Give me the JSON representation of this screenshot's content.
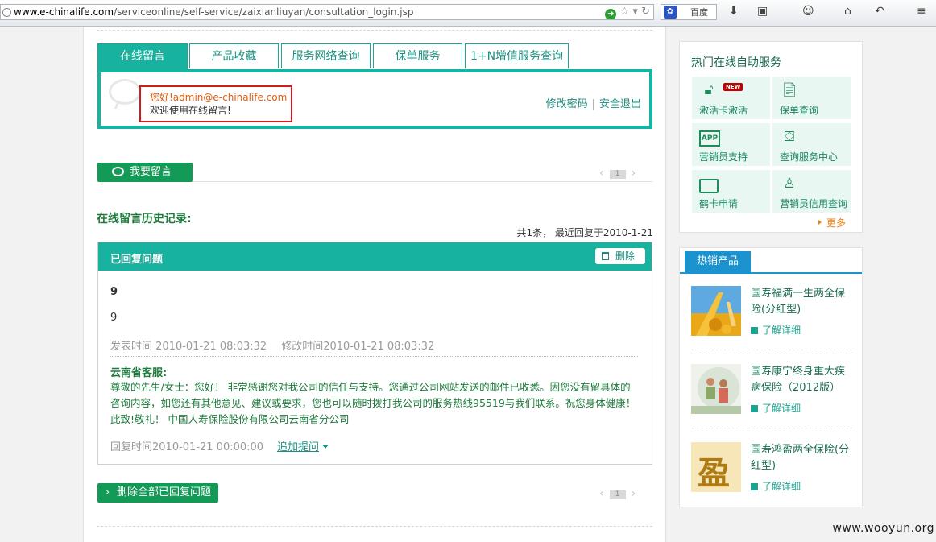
{
  "browser": {
    "url_host": "www.e-chinalife.com",
    "url_path": "/serviceonline/self-service/zaixianliuyan/consultation_login.jsp",
    "search_label": "百度"
  },
  "tabs": [
    {
      "label": "在线留言",
      "active": true
    },
    {
      "label": "产品收藏",
      "active": false
    },
    {
      "label": "服务网络查询",
      "active": false
    },
    {
      "label": "保单服务",
      "active": false
    },
    {
      "label": "1+N增值服务查询",
      "active": false
    }
  ],
  "user": {
    "greeting": "您好!admin@e-chinalife.com",
    "welcome": "欢迎使用在线留言!",
    "change_password": "修改密码",
    "separator": "|",
    "logout": "安全退出"
  },
  "leave_message_button": "我要留言",
  "pager": {
    "prev": "‹",
    "page": "1",
    "next": "›"
  },
  "history": {
    "title": "在线留言历史记录:",
    "summary": "共1条， 最近回复于2010-1-21"
  },
  "message": {
    "header": "已回复问题",
    "delete_label": "删除",
    "title": "9",
    "body": "9",
    "post_time": "发表时间 2010-01-21 08:03:32",
    "modify_time": "修改时间2010-01-21 08:03:32",
    "reply_author": "云南省客服:",
    "reply_text": "尊敬的先生/女士：您好！ 非常感谢您对我公司的信任与支持。您通过公司网站发送的邮件已收悉。因您没有留具体的咨询内容，如您还有其他意见、建议或要求，您也可以随时拨打我公司的服务热线95519与我们联系。祝您身体健康！ 此致!敬礼！ 中国人寿保险股份有限公司云南省分公司",
    "reply_time": "回复时间2010-01-21 00:00:00",
    "add_question": "追加提问"
  },
  "delete_all_button": "删除全部已回复问题",
  "services": {
    "title": "热门在线自助服务",
    "items": [
      {
        "label": "激活卡激活",
        "icon": "unlock-icon",
        "badge": "NEW"
      },
      {
        "label": "保单查询",
        "icon": "document-search-icon"
      },
      {
        "label": "营销员支持",
        "icon": "app-icon",
        "icon_text": "APP"
      },
      {
        "label": "查询服务中心",
        "icon": "map-icon"
      },
      {
        "label": "鹤卡申请",
        "icon": "card-icon"
      },
      {
        "label": "营销员信用查询",
        "icon": "person-search-icon"
      }
    ],
    "more": "更多"
  },
  "hot_products": {
    "tab_label": "热销产品",
    "items": [
      {
        "name": "国寿福满一生两全保险(分红型)",
        "link": "了解详细"
      },
      {
        "name": "国寿康宁终身重大疾病保险（2012版）",
        "link": "了解详细"
      },
      {
        "name": "国寿鸿盈两全保险(分红型)",
        "link": "了解详细",
        "image_text": "盈"
      }
    ]
  },
  "watermark": "www.wooyun.org",
  "colors": {
    "teal": "#18b3a0",
    "green_button": "#149a57",
    "highlight_red": "#d41a1a",
    "blue_tab": "#1a93cf",
    "orange": "#f08011"
  }
}
